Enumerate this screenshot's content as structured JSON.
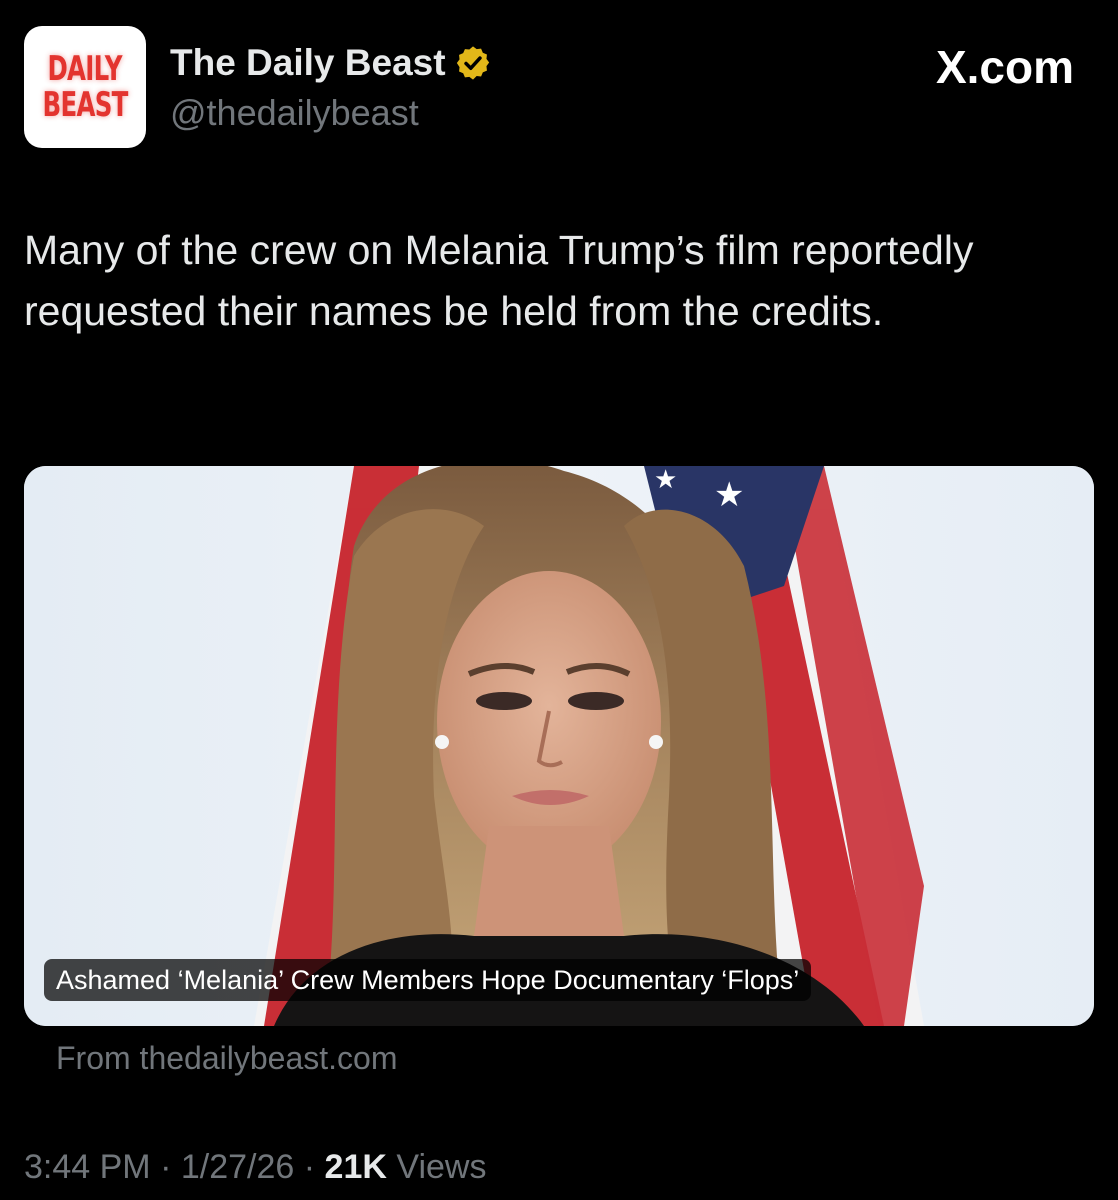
{
  "header": {
    "avatar_lines": [
      "DAILY",
      "BEAST"
    ],
    "display_name": "The Daily Beast",
    "verified_icon": "verified-badge-gold-icon",
    "handle": "@thedailybeast",
    "site_label": "X.com"
  },
  "tweet": {
    "text": "Many of the crew on Melania Trump’s film reportedly requested their names be held from the credits."
  },
  "card": {
    "title": "Ashamed ‘Melania’ Crew Members Hope Documentary ‘Flops’",
    "source": "From thedailybeast.com"
  },
  "meta": {
    "time": "3:44 PM",
    "separator": "·",
    "date": "1/27/26",
    "views_count": "21K",
    "views_label": "Views"
  },
  "colors": {
    "background": "#000000",
    "primary_text": "#e7e9ea",
    "secondary_text": "#71767b",
    "brand_red": "#e3342f",
    "verified_gold": "#e2b719"
  }
}
